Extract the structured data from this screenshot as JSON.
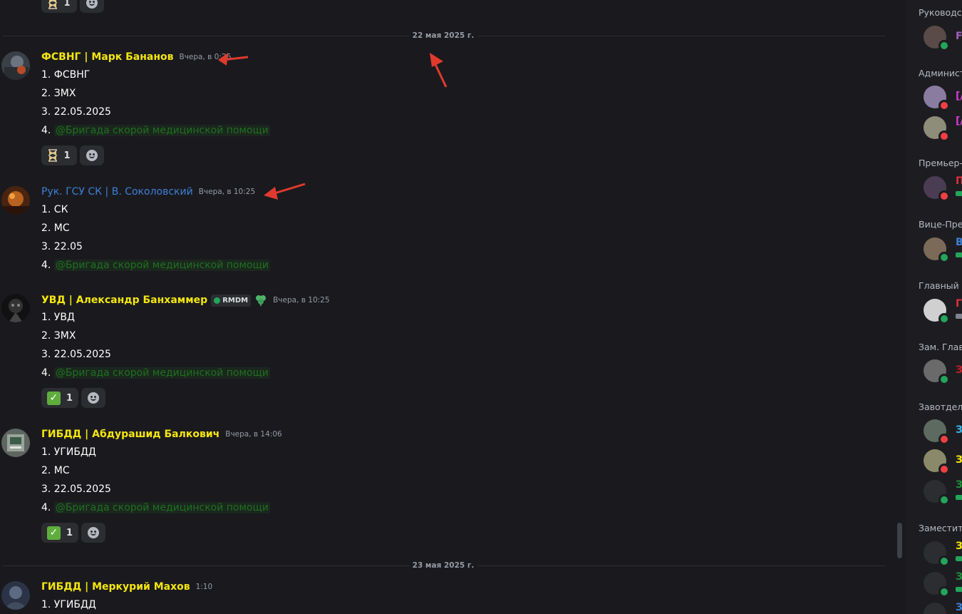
{
  "colors": {
    "yellow_name": "#f5e60f",
    "blue_name": "#3e7fd6",
    "mention": "#1f6f1f",
    "background": "#1a1a1e",
    "arrow": "#e03a2f"
  },
  "dividers": {
    "first": "22 мая 2025 г.",
    "second": "23 мая 2025 г."
  },
  "top_reaction": {
    "emoji": "hourglass-icon",
    "count": "1"
  },
  "messages": [
    {
      "author": "ФСВНГ | Марк Бананов",
      "time": "Вчера, в 0:26",
      "lines": [
        "1. ФСВНГ",
        "2. ЗМХ",
        "3. 22.05.2025",
        "4. "
      ],
      "mention": "@Бригада скорой медицинской помощи",
      "reaction": {
        "emoji": "hourglass-icon",
        "count": "1"
      }
    },
    {
      "author": "Рук. ГСУ СК | В. Соколовский",
      "time": "Вчера, в 10:25",
      "lines": [
        "1. СК",
        "2. МС",
        "3. 22.05",
        "4. "
      ],
      "mention": "@Бригада скорой медицинской помощи"
    },
    {
      "author": "УВД | Александр Банхаммер",
      "tag": "RMDM",
      "time": "Вчера, в 10:25",
      "lines": [
        "1. УВД",
        "2. ЗМХ",
        "3. 22.05.2025",
        "4. "
      ],
      "mention": "@Бригада скорой медицинской помощи",
      "reaction": {
        "emoji": "check-mark-icon",
        "count": "1"
      }
    },
    {
      "author": "ГИБДД | Абдурашид Балкович",
      "time": "Вчера, в 14:06",
      "lines": [
        "1. УГИБДД",
        "2. МС",
        "3. 22.05.2025",
        "4. "
      ],
      "mention": "@Бригада скорой медицинской помощи",
      "reaction": {
        "emoji": "check-mark-icon",
        "count": "1"
      }
    },
    {
      "author": "ГИБДД | Меркурий Махов",
      "time": "1:10",
      "lines": [
        "1. УГИБДД"
      ]
    }
  ],
  "members": {
    "sections": [
      "Руководст",
      "Админист",
      "Премьер-",
      "Вице-Пре",
      "Главный I",
      "Зам. Глав",
      "Завотдело",
      "Заместите"
    ],
    "truncated_names": [
      "F",
      "[/",
      "[/",
      "П",
      "В",
      "Г",
      "З",
      "З",
      "З",
      "З",
      "З",
      "З",
      "З"
    ]
  }
}
